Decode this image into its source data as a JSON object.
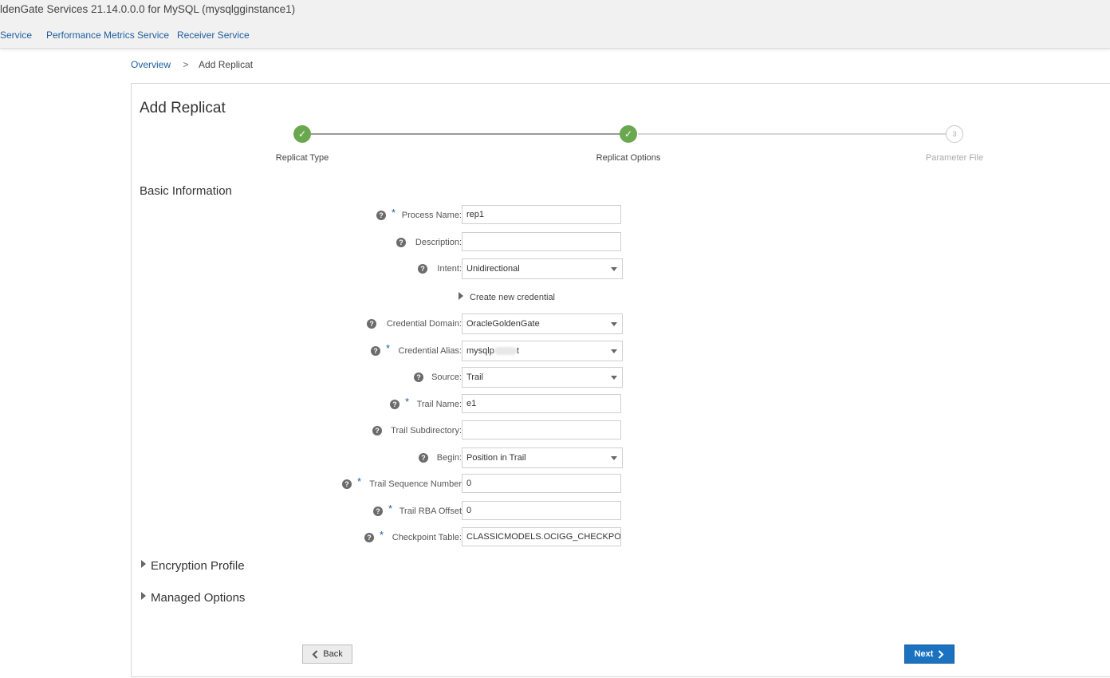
{
  "header": {
    "title": "ldenGate Services 21.14.0.0.0 for MySQL (mysqlgginstance1)",
    "nav": [
      "Service",
      "Performance Metrics Service",
      "Receiver Service"
    ]
  },
  "breadcrumb": {
    "link": "Overview",
    "separator": ">",
    "current": "Add Replicat"
  },
  "page": {
    "title": "Add Replicat"
  },
  "wizard": {
    "steps": [
      {
        "label": "Replicat Type",
        "state": "done"
      },
      {
        "label": "Replicat Options",
        "state": "done"
      },
      {
        "label": "Parameter File",
        "state": "pending",
        "number": "3"
      }
    ]
  },
  "basic_info": {
    "heading": "Basic Information",
    "help_glyph": "?",
    "required_glyph": "*",
    "process_name": {
      "label": "Process Name:",
      "value": "rep1"
    },
    "description": {
      "label": "Description:",
      "value": ""
    },
    "intent": {
      "label": "Intent:",
      "value": "Unidirectional"
    },
    "create_credential": "Create new credential",
    "credential_domain": {
      "label": "Credential Domain:",
      "value": "OracleGoldenGate"
    },
    "credential_alias": {
      "label": "Credential Alias:",
      "value_prefix": "mysqlp",
      "value_suffix": "t"
    },
    "source": {
      "label": "Source:",
      "value": "Trail"
    },
    "trail_name": {
      "label": "Trail Name:",
      "value": "e1"
    },
    "trail_subdirectory": {
      "label": "Trail Subdirectory:",
      "value": ""
    },
    "begin": {
      "label": "Begin:",
      "value": "Position in Trail"
    },
    "trail_sequence_number": {
      "label": "Trail Sequence Number",
      "value": "0"
    },
    "trail_rba_offset": {
      "label": "Trail RBA Offset",
      "value": "0"
    },
    "checkpoint_table": {
      "label": "Checkpoint Table:",
      "value": "CLASSICMODELS.OCIGG_CHECKPOINT"
    }
  },
  "sections": {
    "encryption_profile": "Encryption Profile",
    "managed_options": "Managed Options"
  },
  "buttons": {
    "back": "Back",
    "next": "Next"
  },
  "colors": {
    "accent": "#1a72c0",
    "link": "#1f5e9e",
    "step_done": "#6aa84f"
  }
}
